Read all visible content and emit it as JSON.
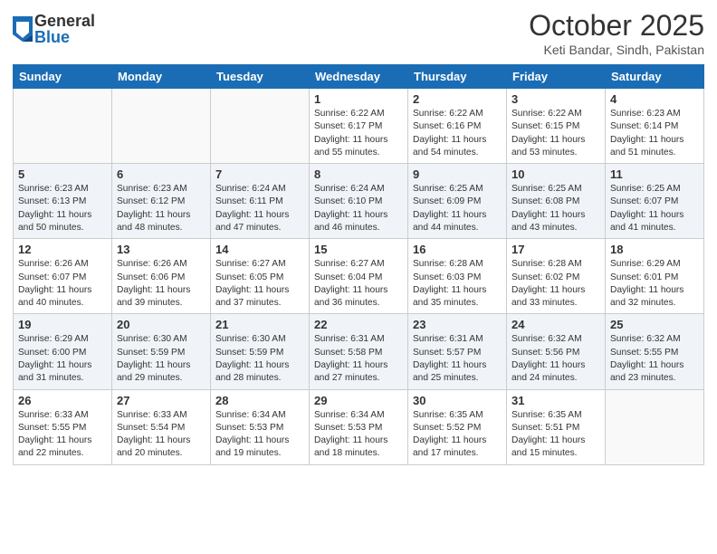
{
  "header": {
    "logo_general": "General",
    "logo_blue": "Blue",
    "title": "October 2025",
    "location": "Keti Bandar, Sindh, Pakistan"
  },
  "weekdays": [
    "Sunday",
    "Monday",
    "Tuesday",
    "Wednesday",
    "Thursday",
    "Friday",
    "Saturday"
  ],
  "weeks": [
    [
      {
        "day": "",
        "info": ""
      },
      {
        "day": "",
        "info": ""
      },
      {
        "day": "",
        "info": ""
      },
      {
        "day": "1",
        "info": "Sunrise: 6:22 AM\nSunset: 6:17 PM\nDaylight: 11 hours\nand 55 minutes."
      },
      {
        "day": "2",
        "info": "Sunrise: 6:22 AM\nSunset: 6:16 PM\nDaylight: 11 hours\nand 54 minutes."
      },
      {
        "day": "3",
        "info": "Sunrise: 6:22 AM\nSunset: 6:15 PM\nDaylight: 11 hours\nand 53 minutes."
      },
      {
        "day": "4",
        "info": "Sunrise: 6:23 AM\nSunset: 6:14 PM\nDaylight: 11 hours\nand 51 minutes."
      }
    ],
    [
      {
        "day": "5",
        "info": "Sunrise: 6:23 AM\nSunset: 6:13 PM\nDaylight: 11 hours\nand 50 minutes."
      },
      {
        "day": "6",
        "info": "Sunrise: 6:23 AM\nSunset: 6:12 PM\nDaylight: 11 hours\nand 48 minutes."
      },
      {
        "day": "7",
        "info": "Sunrise: 6:24 AM\nSunset: 6:11 PM\nDaylight: 11 hours\nand 47 minutes."
      },
      {
        "day": "8",
        "info": "Sunrise: 6:24 AM\nSunset: 6:10 PM\nDaylight: 11 hours\nand 46 minutes."
      },
      {
        "day": "9",
        "info": "Sunrise: 6:25 AM\nSunset: 6:09 PM\nDaylight: 11 hours\nand 44 minutes."
      },
      {
        "day": "10",
        "info": "Sunrise: 6:25 AM\nSunset: 6:08 PM\nDaylight: 11 hours\nand 43 minutes."
      },
      {
        "day": "11",
        "info": "Sunrise: 6:25 AM\nSunset: 6:07 PM\nDaylight: 11 hours\nand 41 minutes."
      }
    ],
    [
      {
        "day": "12",
        "info": "Sunrise: 6:26 AM\nSunset: 6:07 PM\nDaylight: 11 hours\nand 40 minutes."
      },
      {
        "day": "13",
        "info": "Sunrise: 6:26 AM\nSunset: 6:06 PM\nDaylight: 11 hours\nand 39 minutes."
      },
      {
        "day": "14",
        "info": "Sunrise: 6:27 AM\nSunset: 6:05 PM\nDaylight: 11 hours\nand 37 minutes."
      },
      {
        "day": "15",
        "info": "Sunrise: 6:27 AM\nSunset: 6:04 PM\nDaylight: 11 hours\nand 36 minutes."
      },
      {
        "day": "16",
        "info": "Sunrise: 6:28 AM\nSunset: 6:03 PM\nDaylight: 11 hours\nand 35 minutes."
      },
      {
        "day": "17",
        "info": "Sunrise: 6:28 AM\nSunset: 6:02 PM\nDaylight: 11 hours\nand 33 minutes."
      },
      {
        "day": "18",
        "info": "Sunrise: 6:29 AM\nSunset: 6:01 PM\nDaylight: 11 hours\nand 32 minutes."
      }
    ],
    [
      {
        "day": "19",
        "info": "Sunrise: 6:29 AM\nSunset: 6:00 PM\nDaylight: 11 hours\nand 31 minutes."
      },
      {
        "day": "20",
        "info": "Sunrise: 6:30 AM\nSunset: 5:59 PM\nDaylight: 11 hours\nand 29 minutes."
      },
      {
        "day": "21",
        "info": "Sunrise: 6:30 AM\nSunset: 5:59 PM\nDaylight: 11 hours\nand 28 minutes."
      },
      {
        "day": "22",
        "info": "Sunrise: 6:31 AM\nSunset: 5:58 PM\nDaylight: 11 hours\nand 27 minutes."
      },
      {
        "day": "23",
        "info": "Sunrise: 6:31 AM\nSunset: 5:57 PM\nDaylight: 11 hours\nand 25 minutes."
      },
      {
        "day": "24",
        "info": "Sunrise: 6:32 AM\nSunset: 5:56 PM\nDaylight: 11 hours\nand 24 minutes."
      },
      {
        "day": "25",
        "info": "Sunrise: 6:32 AM\nSunset: 5:55 PM\nDaylight: 11 hours\nand 23 minutes."
      }
    ],
    [
      {
        "day": "26",
        "info": "Sunrise: 6:33 AM\nSunset: 5:55 PM\nDaylight: 11 hours\nand 22 minutes."
      },
      {
        "day": "27",
        "info": "Sunrise: 6:33 AM\nSunset: 5:54 PM\nDaylight: 11 hours\nand 20 minutes."
      },
      {
        "day": "28",
        "info": "Sunrise: 6:34 AM\nSunset: 5:53 PM\nDaylight: 11 hours\nand 19 minutes."
      },
      {
        "day": "29",
        "info": "Sunrise: 6:34 AM\nSunset: 5:53 PM\nDaylight: 11 hours\nand 18 minutes."
      },
      {
        "day": "30",
        "info": "Sunrise: 6:35 AM\nSunset: 5:52 PM\nDaylight: 11 hours\nand 17 minutes."
      },
      {
        "day": "31",
        "info": "Sunrise: 6:35 AM\nSunset: 5:51 PM\nDaylight: 11 hours\nand 15 minutes."
      },
      {
        "day": "",
        "info": ""
      }
    ]
  ]
}
